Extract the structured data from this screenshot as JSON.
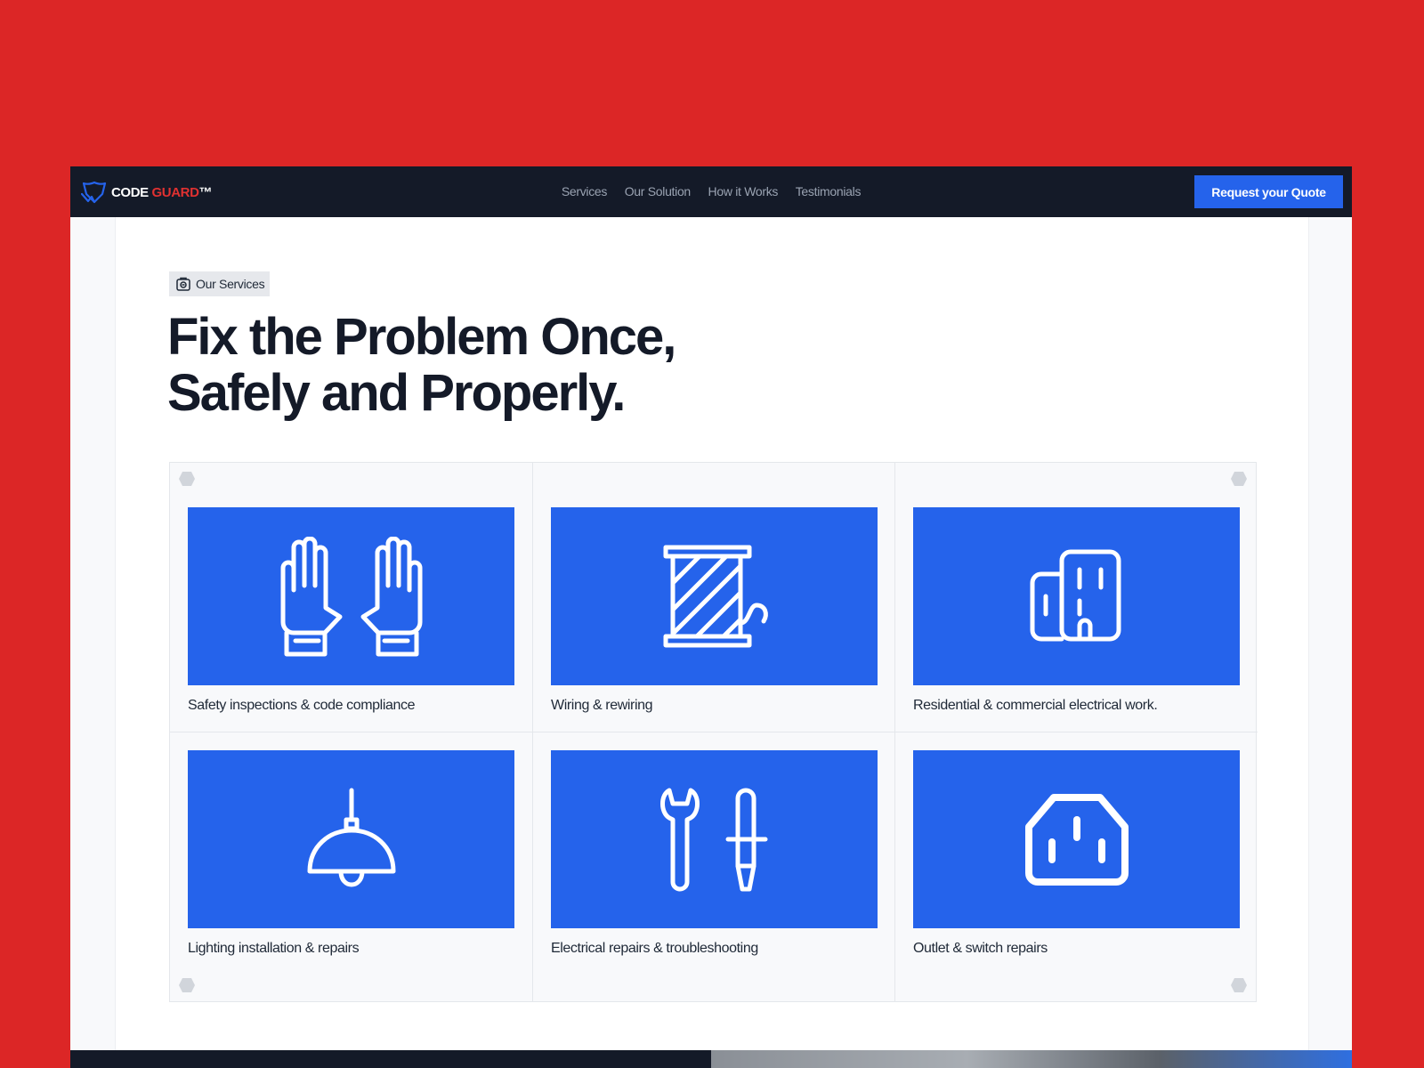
{
  "brand": {
    "name_part1": "CODE",
    "name_part2": "GUARD",
    "trademark": "™"
  },
  "nav": {
    "links": [
      "Services",
      "Our Solution",
      "How it Works",
      "Testimonials"
    ],
    "cta_label": "Request your Quote"
  },
  "section": {
    "badge_label": "Our Services",
    "headline_line1": "Fix the Problem Once,",
    "headline_line2": "Safely and Properly."
  },
  "services": [
    {
      "label": "Safety inspections & code compliance",
      "icon": "gloves-icon"
    },
    {
      "label": "Wiring & rewiring",
      "icon": "wire-spool-icon"
    },
    {
      "label": "Residential & commercial electrical work.",
      "icon": "buildings-icon"
    },
    {
      "label": "Lighting installation & repairs",
      "icon": "pendant-lamp-icon"
    },
    {
      "label": "Electrical repairs & troubleshooting",
      "icon": "wrench-screwdriver-icon"
    },
    {
      "label": "Outlet & switch repairs",
      "icon": "power-outlet-icon"
    }
  ],
  "colors": {
    "background": "#dc2626",
    "nav_bg": "#141a28",
    "accent": "#2563eb",
    "brand_red": "#e03131",
    "text": "#141a28"
  }
}
